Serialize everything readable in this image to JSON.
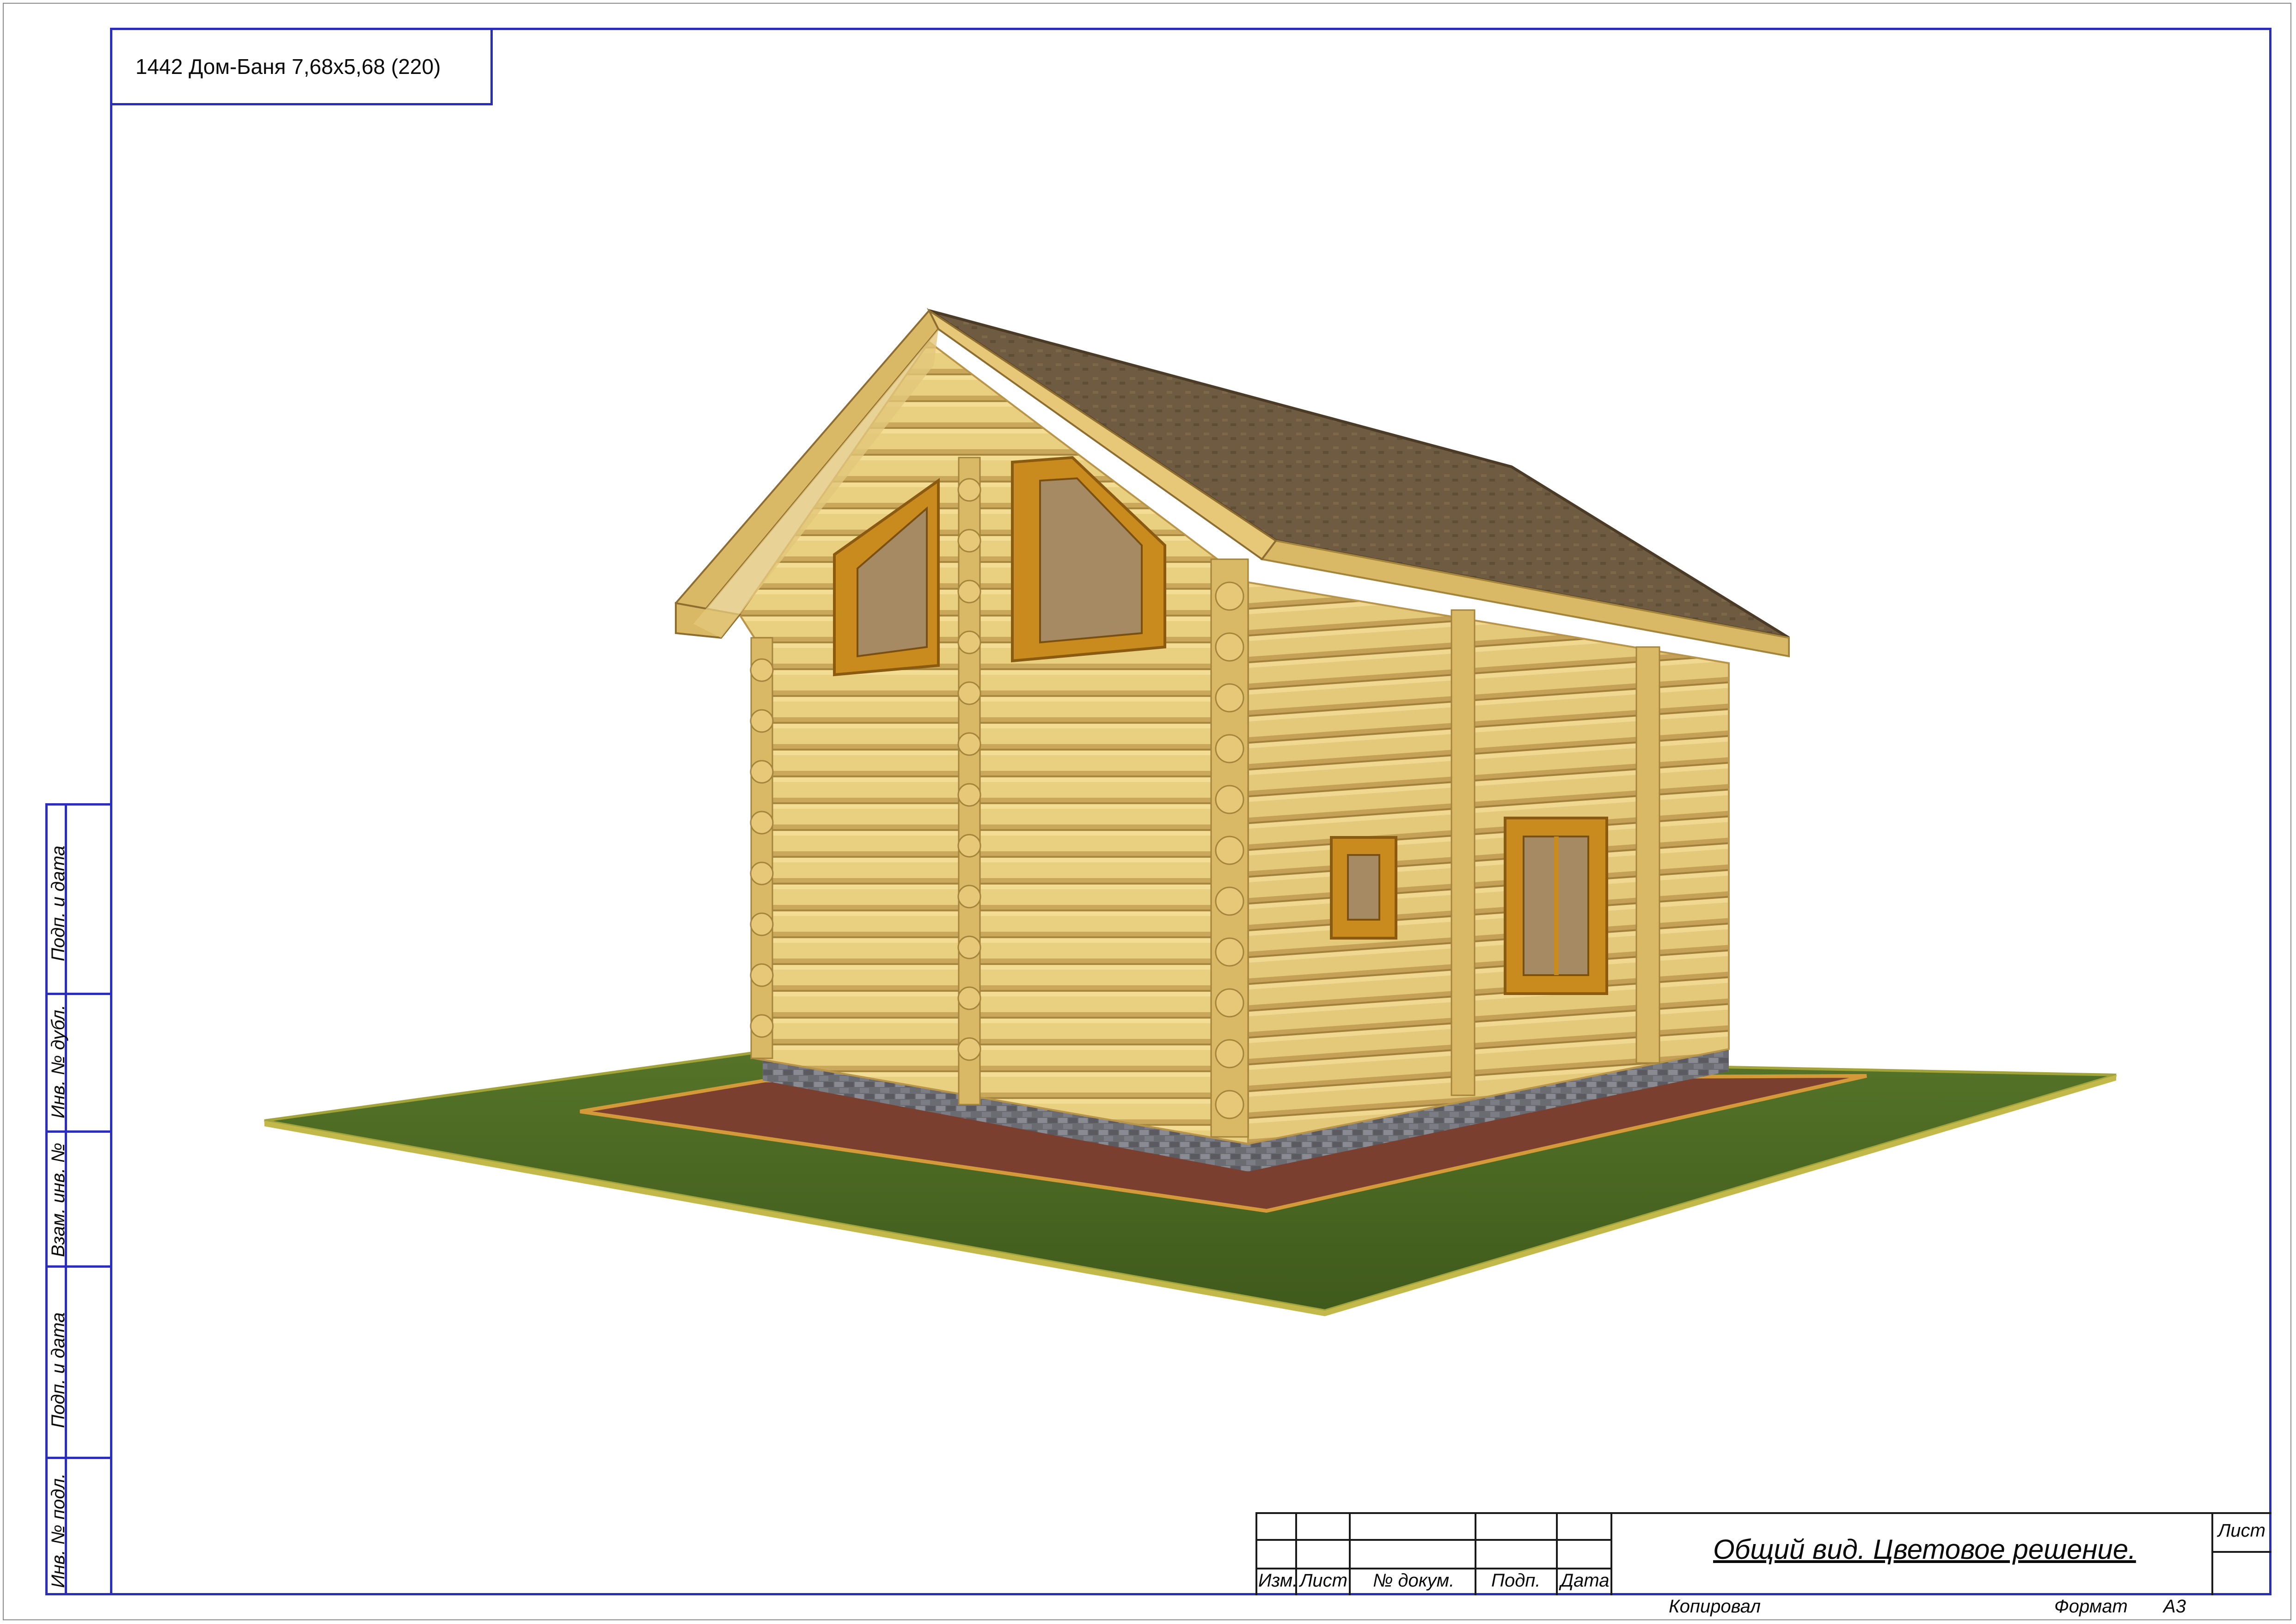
{
  "sheet": {
    "project_title": "1442 Дом-Баня 7,68х5,68 (220)"
  },
  "side_stamp": {
    "labels": [
      "Подп. и дата",
      "Инв. № дубл.",
      "Взам. инв. №",
      "Подп. и дата",
      "Инв. № подл."
    ]
  },
  "title_block": {
    "columns": [
      "Изм.",
      "Лист",
      "№ докум.",
      "Подп.",
      "Дата"
    ],
    "description": "Общий вид. Цветовое решение.",
    "sheet_label": "Лист",
    "copied_label": "Копировал",
    "format_label": "Формат",
    "format_value": "А3"
  },
  "colors": {
    "frame": "#2b2fb8",
    "log_wall": "#e6cc7c",
    "log_wall_shadow": "#c9a95a",
    "roof": "#6e5a40",
    "trim": "#c98a1e",
    "plinth": "#6a6a70",
    "path": "#7a3e2e",
    "grass": "#4c6a22"
  }
}
